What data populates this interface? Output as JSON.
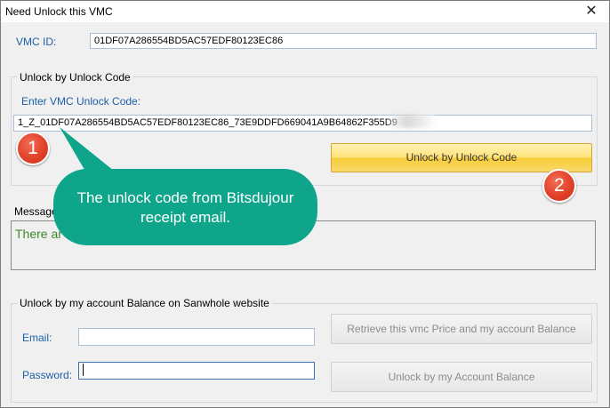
{
  "window": {
    "title": "Need Unlock this VMC"
  },
  "vmc": {
    "id_label": "VMC ID:",
    "id_value": "01DF07A286554BD5AC57EDF80123EC86"
  },
  "unlock_code_group": {
    "title": "Unlock by Unlock Code",
    "field_label": "Enter VMC Unlock Code:",
    "field_value": "1_Z_01DF07A286554BD5AC57EDF80123EC86_73E9DDFD669041A9B64862F355D9",
    "button_label": "Unlock by Unlock Code"
  },
  "message": {
    "label": "Message",
    "text": "There ar"
  },
  "balance_group": {
    "title": "Unlock by my account Balance on Sanwhole website",
    "email_label": "Email:",
    "email_value": "",
    "password_label": "Password:",
    "password_value": "",
    "retrieve_button": "Retrieve this vmc Price and my account Balance",
    "unlock_button": "Unlock by my Account Balance"
  },
  "annotations": {
    "badge1": "1",
    "badge2": "2",
    "callout_text": "The unlock code from Bitsdujour receipt email.",
    "callout_color": "#0ea58b",
    "badge_color": "#e2412a"
  }
}
